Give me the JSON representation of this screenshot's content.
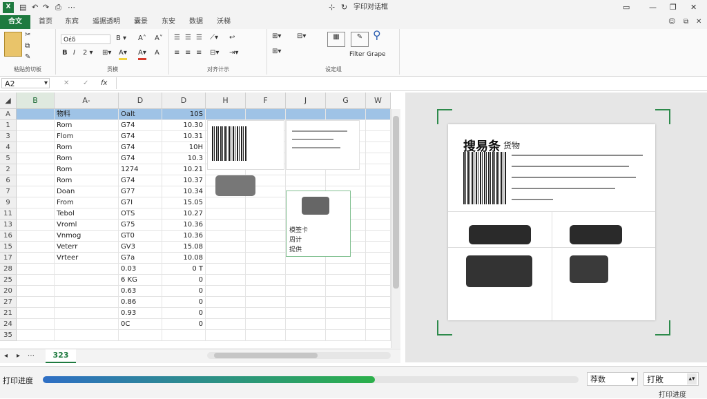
{
  "window": {
    "title": "字印对话框"
  },
  "ribbon_tabs": [
    "合文",
    "首页",
    "东宾",
    "遥据透明",
    "囊景",
    "东安",
    "数据",
    "沃梯"
  ],
  "ribbon": {
    "clipboard_label": "粘贴剪切板",
    "font_label": "贡模",
    "font_name": "Oέδ",
    "align_label": "对齐计示",
    "edit_label": "设定组",
    "sort_label": "Filter Grape",
    "font_group_label": "贡模"
  },
  "formula": {
    "cell_ref": "A2",
    "value": ""
  },
  "columns": [
    "B",
    "A-",
    "D",
    "D",
    "H",
    "F",
    "J",
    "G",
    "W"
  ],
  "rows": [
    {
      "n": "A",
      "c1": "",
      "c2": "物料",
      "c3": "Oalt",
      "c4": "10S"
    },
    {
      "n": "1",
      "c1": "",
      "c2": "Rom",
      "c3": "G74",
      "c4": "10.30"
    },
    {
      "n": "3",
      "c1": "",
      "c2": "Flom",
      "c3": "G74",
      "c4": "10.31"
    },
    {
      "n": "4",
      "c1": "",
      "c2": "Rom",
      "c3": "G74",
      "c4": "10H"
    },
    {
      "n": "5",
      "c1": "",
      "c2": "Rom",
      "c3": "G74",
      "c4": "10.3"
    },
    {
      "n": "2",
      "c1": "",
      "c2": "Rom",
      "c3": "1274",
      "c4": "10.21"
    },
    {
      "n": "6",
      "c1": "",
      "c2": "Rom",
      "c3": "G74",
      "c4": "10.37"
    },
    {
      "n": "7",
      "c1": "",
      "c2": "Doan",
      "c3": "G77",
      "c4": "10.34"
    },
    {
      "n": "9",
      "c1": "",
      "c2": "From",
      "c3": "G7I",
      "c4": "15.05"
    },
    {
      "n": "11",
      "c1": "",
      "c2": "Tebol",
      "c3": "OTS",
      "c4": "10.27"
    },
    {
      "n": "13",
      "c1": "",
      "c2": "Vroml",
      "c3": "G75",
      "c4": "10.36"
    },
    {
      "n": "16",
      "c1": "",
      "c2": "Vnmog",
      "c3": "GT0",
      "c4": "10.36"
    },
    {
      "n": "15",
      "c1": "",
      "c2": "Veterr",
      "c3": "GV3",
      "c4": "15.08"
    },
    {
      "n": "17",
      "c1": "",
      "c2": "Vrteer",
      "c3": "G7a",
      "c4": "10.08"
    },
    {
      "n": "28",
      "c1": "",
      "c2": "",
      "c3": "0.03",
      "c4": "0 T"
    },
    {
      "n": "25",
      "c1": "",
      "c2": "",
      "c3": "6 KG",
      "c4": "0"
    },
    {
      "n": "20",
      "c1": "",
      "c2": "",
      "c3": "0.63",
      "c4": "0"
    },
    {
      "n": "27",
      "c1": "",
      "c2": "",
      "c3": "0.86",
      "c4": "0"
    },
    {
      "n": "21",
      "c1": "",
      "c2": "",
      "c3": "0.93",
      "c4": "0"
    },
    {
      "n": "24",
      "c1": "",
      "c2": "",
      "c3": "0C",
      "c4": "0"
    },
    {
      "n": "35",
      "c1": "",
      "c2": "",
      "c3": "",
      "c4": ""
    }
  ],
  "context_menu": [
    "模签卡",
    "周计",
    "提供"
  ],
  "sheet_tab": "323",
  "preview": {
    "title": "搜易条",
    "subtitle": "货物"
  },
  "status": {
    "progress_label": "打印进度",
    "progress": 0.62,
    "copies_label": "荐数",
    "print_option": "打敗",
    "footer_label": "打印进度"
  },
  "colors": {
    "accent": "#1e7a3f",
    "selection": "#9fc3e6",
    "progress_start": "#2f6fc5",
    "progress_end": "#2bb04a"
  }
}
